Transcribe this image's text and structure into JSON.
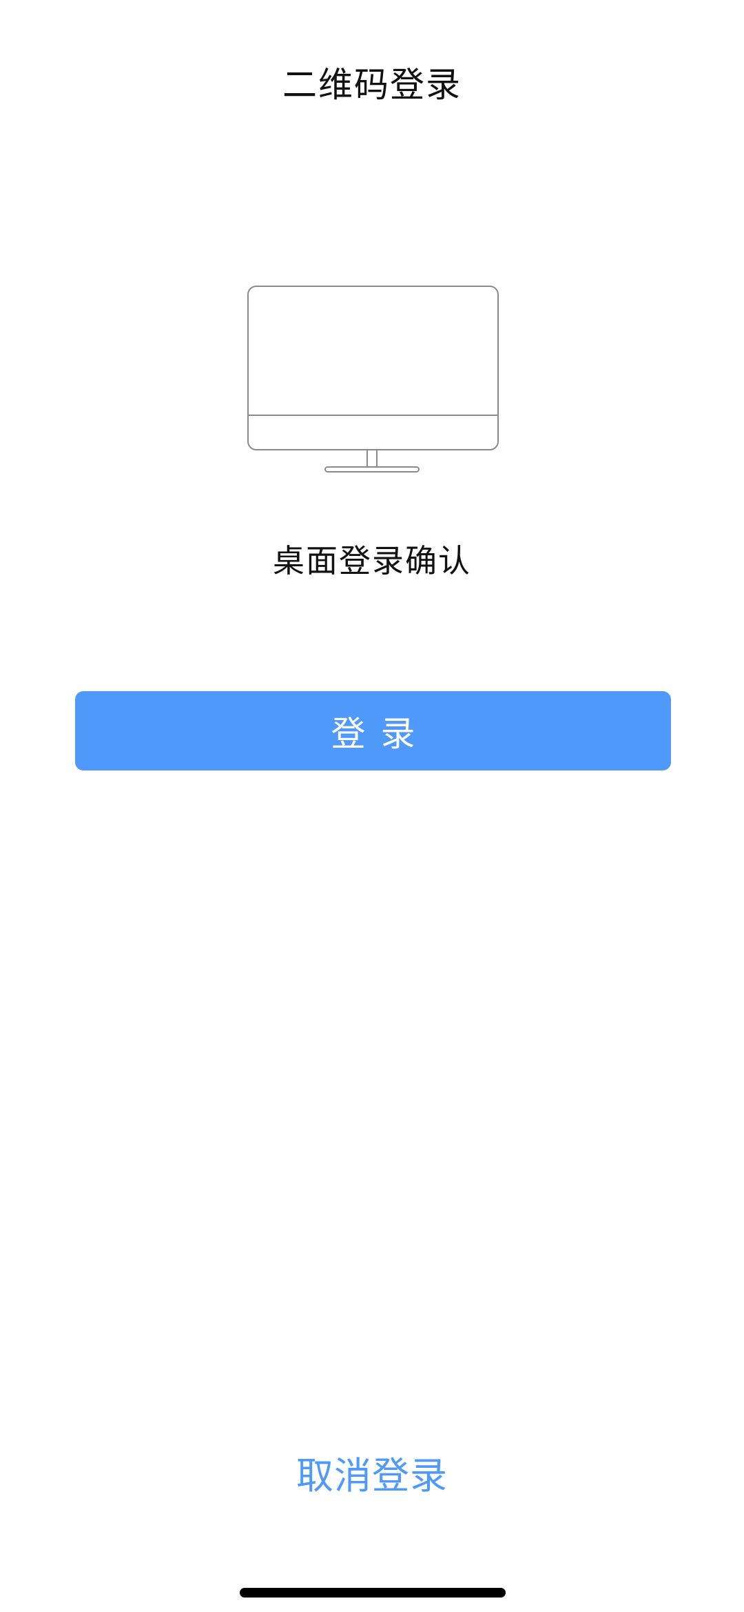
{
  "header": {
    "title": "二维码登录"
  },
  "illustration": {
    "icon": "desktop-monitor-icon"
  },
  "content": {
    "confirm_text": "桌面登录确认"
  },
  "actions": {
    "login_label": "登录",
    "cancel_label": "取消登录"
  },
  "colors": {
    "accent": "#4f99fb",
    "background": "#ffffff",
    "text": "#111111",
    "outline": "#8a8a8a"
  }
}
